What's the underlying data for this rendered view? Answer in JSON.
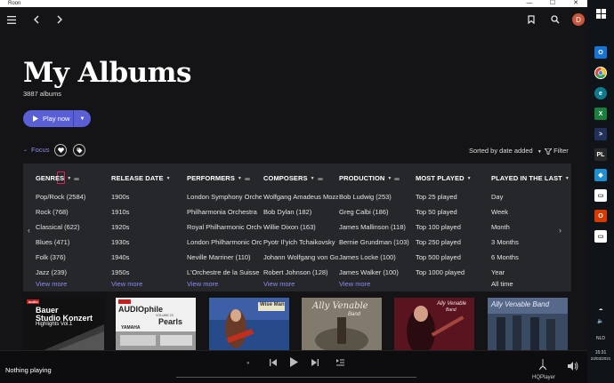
{
  "window": {
    "title": "Roon",
    "minimize": "—",
    "maximize": "☐",
    "close": "✕"
  },
  "header": {
    "avatar_letter": "D"
  },
  "page": {
    "title": "My Albums",
    "count": "3887 albums",
    "play_now": "Play now",
    "focus": "Focus",
    "sorted": "Sorted by date added",
    "filter": "Filter"
  },
  "focus_panel": {
    "columns": [
      {
        "header": "GENRES",
        "items": [
          "Pop/Rock (2584)",
          "Rock (768)",
          "Classical (622)",
          "Blues (471)",
          "Folk (376)",
          "Jazz (239)"
        ],
        "view_more": "View more"
      },
      {
        "header": "RELEASE DATE",
        "items": [
          "1900s",
          "1910s",
          "1920s",
          "1930s",
          "1940s",
          "1950s"
        ],
        "view_more": "View more"
      },
      {
        "header": "PERFORMERS",
        "items": [
          "London Symphony Orchestra",
          "Philharmonia Orchestra",
          "Royal Philharmonic Orchestra",
          "London Philharmonic Orchestra",
          "Neville Marriner (110)",
          "L'Orchestre de la Suisse Romande"
        ],
        "view_more": "View more"
      },
      {
        "header": "COMPOSERS",
        "items": [
          "Wolfgang Amadeus Mozart",
          "Bob Dylan (182)",
          "Willie Dixon (163)",
          "Pyotr Il'yich Tchaikovsky",
          "Johann Wolfgang von Goethe",
          "Robert Johnson (128)"
        ],
        "view_more": "View more"
      },
      {
        "header": "PRODUCTION",
        "items": [
          "Bob Ludwig (253)",
          "Greg Calbi (186)",
          "James Mallinson (118)",
          "Bernie Grundman (103)",
          "James Locke (100)",
          "James Walker (100)"
        ],
        "view_more": "View more"
      },
      {
        "header": "MOST PLAYED",
        "items": [
          "Top 25 played",
          "Top 50 played",
          "Top 100 played",
          "Top 250 played",
          "Top 500 played",
          "Top 1000 played"
        ],
        "view_more": ""
      },
      {
        "header": "PLAYED IN THE LAST",
        "items": [
          "Day",
          "Week",
          "Month",
          "3 Months",
          "6 Months",
          "Year"
        ],
        "view_more": "All time"
      }
    ]
  },
  "albums": [
    {
      "line1": "Bauer",
      "line2": "Studio Konzert",
      "line3": "Highlights Vol.1",
      "badge": "audio"
    },
    {
      "line1": "AUDIOphile",
      "line2": "Pearls",
      "line3": "YAMAHA",
      "badge": "VOLUME 23"
    },
    {
      "line1": "Wise Man",
      "line2": "",
      "line3": "",
      "badge": ""
    },
    {
      "line1": "Ally Venable",
      "line2": "Band",
      "line3": "",
      "badge": ""
    },
    {
      "line1": "Ally Venable",
      "line2": "Band",
      "line3": "",
      "badge": ""
    },
    {
      "line1": "Ally Venable Band",
      "line2": "",
      "line3": "",
      "badge": ""
    }
  ],
  "player": {
    "status": "Nothing playing",
    "zone": "HQPlayer"
  },
  "taskbar": {
    "lang": "NLD",
    "time": "15:31",
    "date": "23/03/2021"
  }
}
